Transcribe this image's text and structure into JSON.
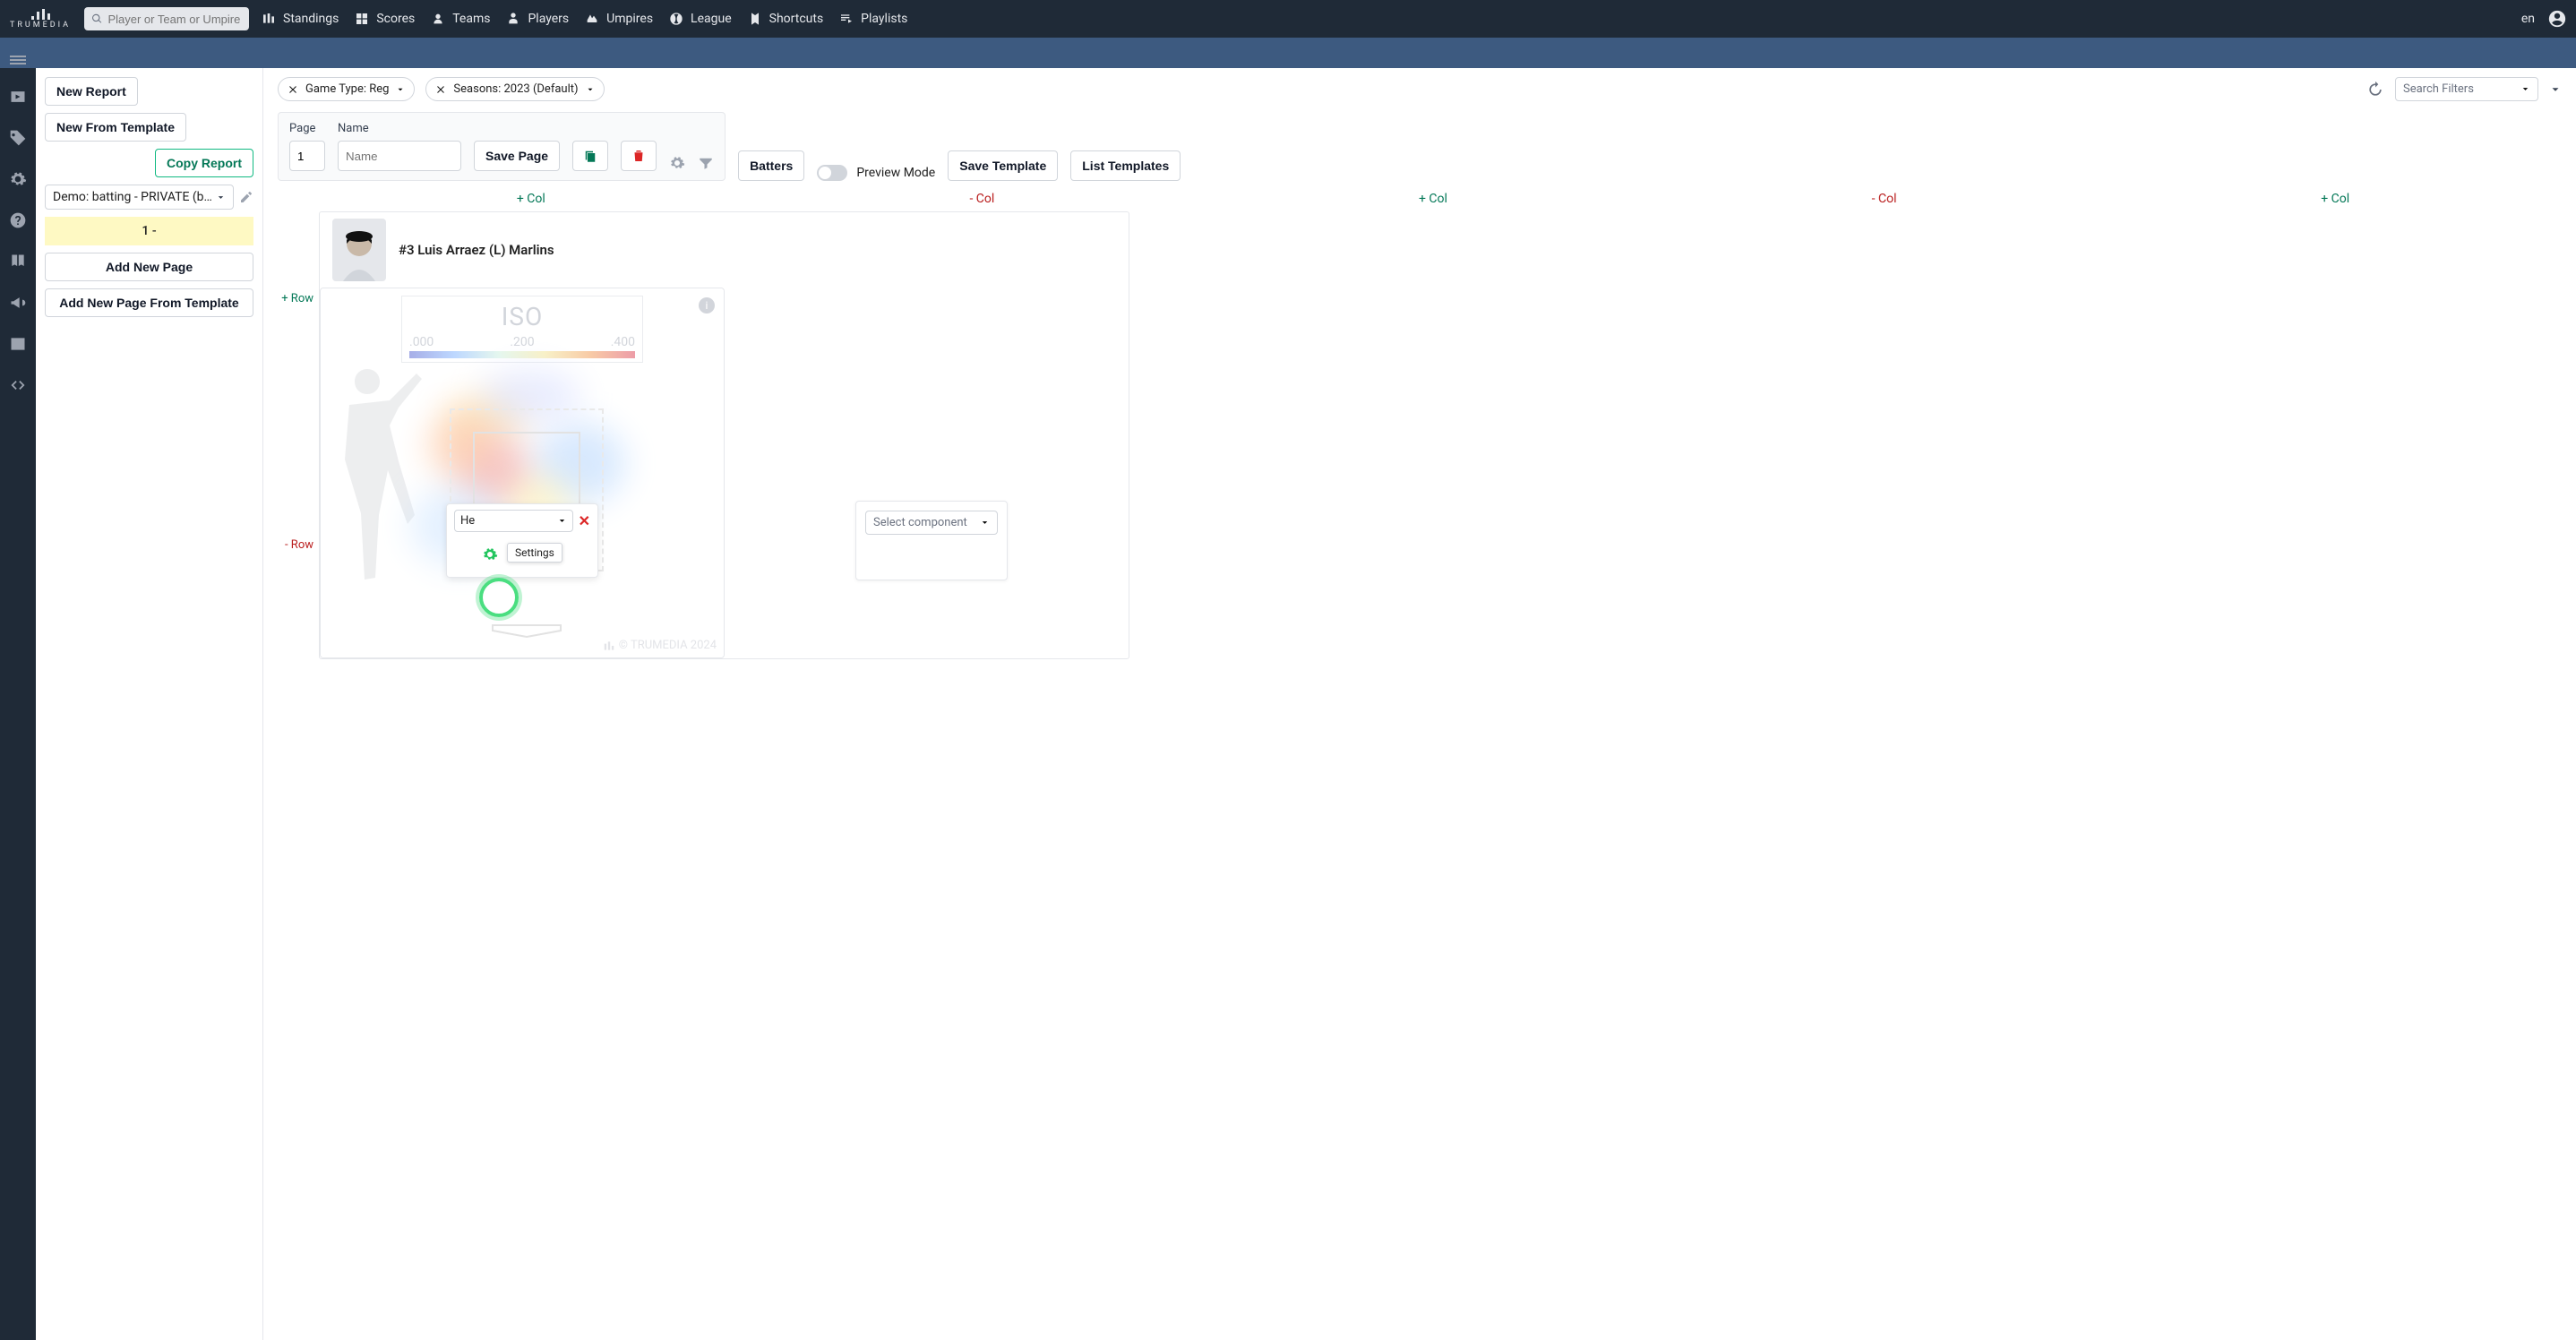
{
  "brand": "TRUMEDIA",
  "search": {
    "placeholder": "Player or Team or Umpire"
  },
  "nav": {
    "standings": "Standings",
    "scores": "Scores",
    "teams": "Teams",
    "players": "Players",
    "umpires": "Umpires",
    "league": "League",
    "shortcuts": "Shortcuts",
    "playlists": "Playlists"
  },
  "lang": "en",
  "left": {
    "new_report": "New Report",
    "new_from_template": "New From Template",
    "copy_report": "Copy Report",
    "report_selector": "Demo: batting - PRIVATE (brad...",
    "active_page": "1 -",
    "add_new_page": "Add New Page",
    "add_new_page_template": "Add New Page From Template"
  },
  "filters": {
    "game_type": "Game Type: Reg",
    "seasons": "Seasons: 2023 (Default)",
    "search_filters_placeholder": "Search Filters"
  },
  "toolbar": {
    "page_label": "Page",
    "page_value": "1",
    "name_label": "Name",
    "name_placeholder": "Name",
    "save_page": "Save Page",
    "batters": "Batters",
    "preview_mode": "Preview Mode",
    "save_template": "Save Template",
    "list_templates": "List Templates"
  },
  "grid": {
    "add_col": "+ Col",
    "del_col": "- Col",
    "add_row": "+ Row",
    "del_row": "- Row"
  },
  "player": {
    "display": "#3 Luis Arraez (L) Marlins"
  },
  "heatmap": {
    "legend_title": "ISO",
    "legend_min": ".000",
    "legend_mid": ".200",
    "legend_max": ".400",
    "watermark": "© TRUMEDIA 2024",
    "info_glyph": "i"
  },
  "popup": {
    "selected_text": "He",
    "tooltip": "Settings",
    "close": "✕"
  },
  "empty": {
    "select_component": "Select component"
  }
}
